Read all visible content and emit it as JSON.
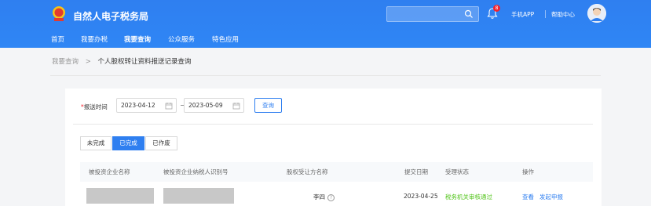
{
  "header": {
    "brand": "自然人电子税务局",
    "search_placeholder": "",
    "notification_count": "8",
    "mobile_app_label": "手机APP",
    "help_center_label": "帮助中心",
    "brand_color": "#2f7ff0"
  },
  "nav": {
    "items": [
      {
        "label": "首页"
      },
      {
        "label": "我要办税"
      },
      {
        "label": "我要查询"
      },
      {
        "label": "公众服务"
      },
      {
        "label": "特色应用"
      }
    ],
    "active": "我要查询"
  },
  "breadcrumb": {
    "root": "我要查询",
    "separator": ">",
    "current": "个人股权转让资料报送记录查询"
  },
  "filter": {
    "label": "报送时间",
    "start_date": "2023-04-12",
    "end_date": "2023-05-09",
    "query_button": "查询"
  },
  "tabs": [
    {
      "label": "未完成"
    },
    {
      "label": "已完成"
    },
    {
      "label": "已作废"
    }
  ],
  "active_tab": "已完成",
  "table": {
    "columns": [
      "被投资企业名称",
      "被投资企业纳税人识别号",
      "股权受让方名称",
      "提交日期",
      "受理状态",
      "操作"
    ],
    "rows": [
      {
        "company_name": "",
        "taxpayer_id": "",
        "transferee": "李四",
        "submit_date": "2023-04-25",
        "status": "税务机关审核通过",
        "actions": [
          "查看",
          "发起申报"
        ]
      }
    ]
  },
  "icons": {
    "logo": "tax-emblem-icon",
    "search": "search-icon",
    "notification": "bell-icon",
    "avatar": "user-avatar-icon",
    "calendar": "calendar-icon",
    "help": "question-circle-icon"
  },
  "colors": {
    "primary": "#2f7ff0",
    "success": "#52c41a",
    "badge": "#f5222d"
  }
}
